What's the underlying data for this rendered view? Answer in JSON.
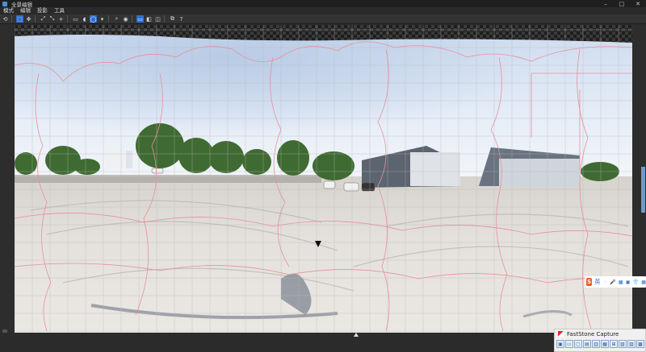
{
  "window": {
    "title": "全景编辑",
    "controls": [
      "–",
      "□",
      "✕"
    ]
  },
  "menu": [
    "模式",
    "编辑",
    "投影",
    "工具"
  ],
  "toolbar": [
    {
      "icon": "undo-icon",
      "glyph": "⟲"
    },
    {
      "icon": "select-icon",
      "glyph": "⬚",
      "active": true
    },
    {
      "icon": "move-icon",
      "glyph": "✥"
    },
    {
      "icon": "fit-icon",
      "glyph": "⤢"
    },
    {
      "icon": "fullscreen-icon",
      "glyph": "⤡"
    },
    {
      "icon": "crosshair-icon",
      "glyph": "+"
    },
    {
      "icon": "rectangle-icon",
      "glyph": "▭"
    },
    {
      "icon": "mouse-icon",
      "glyph": "◖"
    },
    {
      "icon": "lasso-icon",
      "glyph": "◯",
      "active": true
    },
    {
      "icon": "dropdown-icon",
      "glyph": "▾"
    },
    {
      "icon": "zoom-icon",
      "glyph": "⌕"
    },
    {
      "icon": "eye-icon",
      "glyph": "◉"
    },
    {
      "icon": "layout-single-icon",
      "glyph": "▭",
      "active": true
    },
    {
      "icon": "layout-split-icon",
      "glyph": "◧"
    },
    {
      "icon": "layout-mirror-icon",
      "glyph": "◫"
    },
    {
      "icon": "copy-icon",
      "glyph": "⧉"
    },
    {
      "icon": "help-icon",
      "glyph": "?"
    }
  ],
  "ime": {
    "logo": "S",
    "label": "英",
    "icons": [
      "·",
      "🎤",
      "▦",
      "▣",
      "👕",
      "▦"
    ]
  },
  "fastone": {
    "title": "FastStone Capture",
    "buttons": [
      "▣",
      "▭",
      "▢",
      "▤",
      "▥",
      "▦",
      "⊞",
      "▧",
      "▨",
      "▩"
    ]
  },
  "colors": {
    "accent": "#2f6fcf",
    "seam": "#e8909a"
  }
}
